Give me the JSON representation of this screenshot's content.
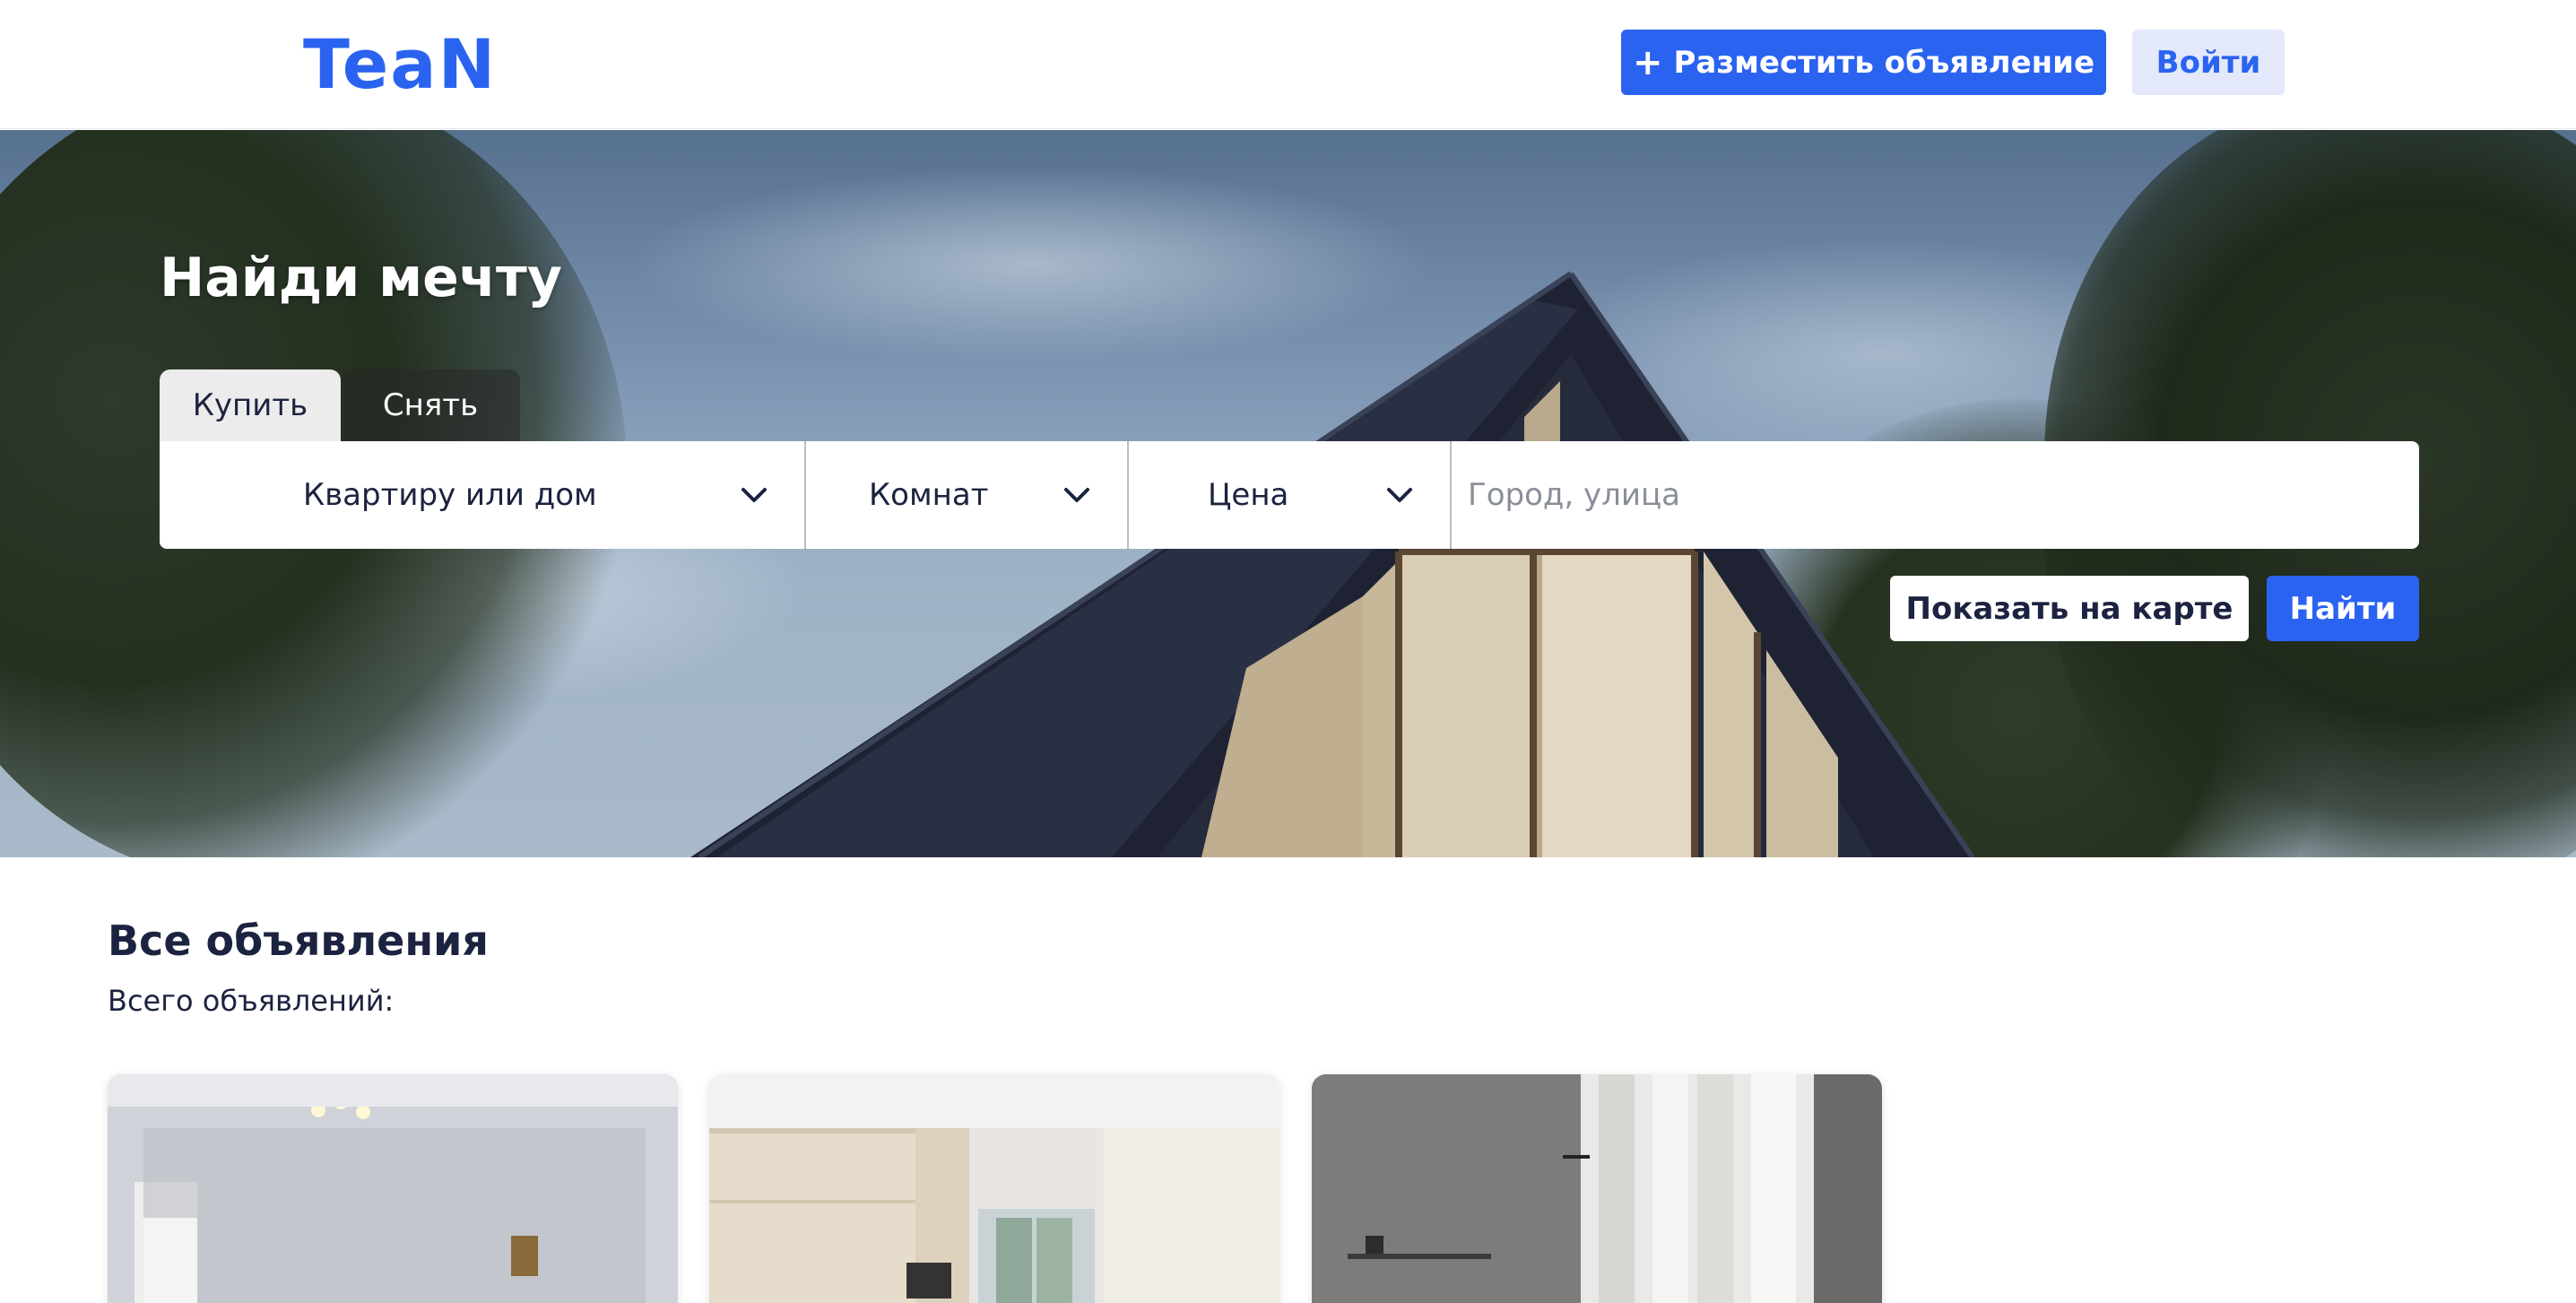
{
  "header": {
    "logo": "TeaN",
    "post_button": {
      "icon": "plus-icon",
      "label": "Разместить объявление"
    },
    "login_label": "Войти"
  },
  "hero": {
    "title": "Найди мечту",
    "tabs": [
      {
        "label": "Купить",
        "active": true
      },
      {
        "label": "Снять",
        "active": false
      }
    ],
    "filters": {
      "property_type": "Квартиру или дом",
      "rooms": "Комнат",
      "price": "Цена"
    },
    "location_placeholder": "Город, улица",
    "map_button_label": "Показать на карте",
    "search_button_label": "Найти"
  },
  "listings": {
    "title": "Все объявления",
    "count_label": "Всего объявлений:",
    "cards": [
      {
        "photo": "room-with-wallpaper-photo"
      },
      {
        "photo": "kitchen-photo"
      },
      {
        "photo": "living-room-photo"
      }
    ]
  },
  "colors": {
    "accent": "#2b63f1",
    "accent_light": "#e3e9fb",
    "text_dark": "#1c2340"
  }
}
